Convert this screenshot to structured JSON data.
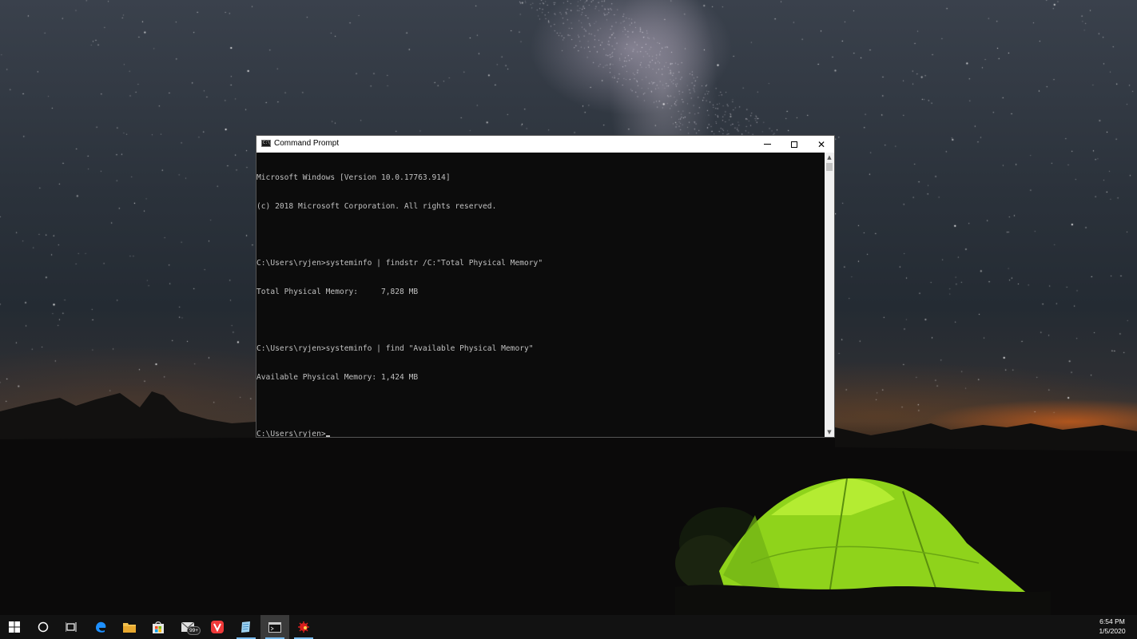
{
  "desktop": {
    "wallpaper": "night-sky-with-milky-way-and-green-tent",
    "colors": {
      "sky": "#2b323b",
      "horizon_glow": "#d25f19",
      "tent": "#9ee01e"
    }
  },
  "window": {
    "title": "Command Prompt",
    "icon": "console-icon",
    "controls": [
      "minimize-icon",
      "maximize-icon",
      "close-icon"
    ],
    "console_lines": [
      "Microsoft Windows [Version 10.0.17763.914]",
      "(c) 2018 Microsoft Corporation. All rights reserved.",
      "",
      "C:\\Users\\ryjen>systeminfo | findstr /C:\"Total Physical Memory\"",
      "Total Physical Memory:     7,828 MB",
      "",
      "C:\\Users\\ryjen>systeminfo | find \"Available Physical Memory\"",
      "Available Physical Memory: 1,424 MB",
      "",
      "C:\\Users\\ryjen>"
    ],
    "colors": {
      "background": "#0c0c0c",
      "text": "#c0c0c0",
      "titlebar": "#ffffff"
    }
  },
  "taskbar": {
    "items": [
      {
        "icon": "windows-start-icon"
      },
      {
        "icon": "cortana-search-icon"
      },
      {
        "icon": "task-view-icon"
      },
      {
        "icon": "edge-browser-icon"
      },
      {
        "icon": "file-explorer-icon"
      },
      {
        "icon": "microsoft-store-icon"
      },
      {
        "icon": "mail-icon",
        "badge": "99+"
      },
      {
        "icon": "vivaldi-browser-icon"
      },
      {
        "icon": "notepad-icon"
      },
      {
        "icon": "command-prompt-icon"
      },
      {
        "icon": "red-app-icon"
      }
    ],
    "clock": {
      "time": "6:54 PM",
      "date": "1/5/2020"
    }
  }
}
